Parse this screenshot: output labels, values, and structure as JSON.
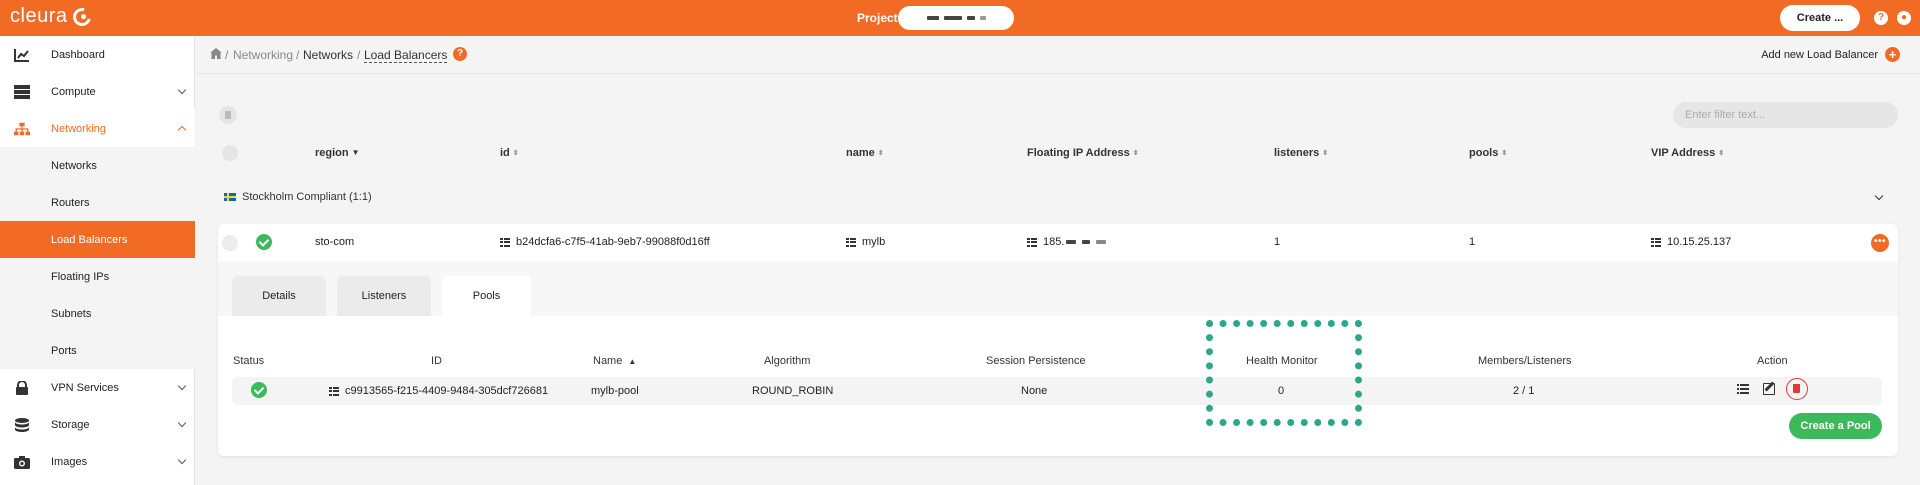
{
  "topbar": {
    "brand": "cleura",
    "project_label": "Project",
    "create_label": "Create ...",
    "accent_color": "#f26b25"
  },
  "sidebar": {
    "items": [
      {
        "label": "Dashboard",
        "icon": "chart-icon"
      },
      {
        "label": "Compute",
        "icon": "server-icon"
      },
      {
        "label": "Networking",
        "icon": "network-icon"
      },
      {
        "label": "Networks"
      },
      {
        "label": "Routers"
      },
      {
        "label": "Load Balancers"
      },
      {
        "label": "Floating IPs"
      },
      {
        "label": "Subnets"
      },
      {
        "label": "Ports"
      },
      {
        "label": "VPN Services",
        "icon": "lock-icon"
      },
      {
        "label": "Storage",
        "icon": "database-icon"
      },
      {
        "label": "Images",
        "icon": "camera-icon"
      }
    ]
  },
  "breadcrumb": {
    "sep": "/",
    "networking": "Networking",
    "networks": "Networks",
    "current": "Load Balancers"
  },
  "header": {
    "add_label": "Add new Load Balancer"
  },
  "filter": {
    "placeholder": "Enter filter text..."
  },
  "table": {
    "headers": {
      "region": "region",
      "id": "id",
      "name": "name",
      "fip": "Floating IP Address",
      "listeners": "listeners",
      "pools": "pools",
      "vip": "VIP Address"
    },
    "region_group": "Stockholm Compliant (1:1)",
    "row": {
      "region": "sto-com",
      "id": "b24dcfa6-c7f5-41ab-9eb7-99088f0d16ff",
      "name": "mylb",
      "fip_prefix": "185.",
      "listeners": "1",
      "pools": "1",
      "vip": "10.15.25.137"
    }
  },
  "tabs": [
    "Details",
    "Listeners",
    "Pools"
  ],
  "pools": {
    "headers": {
      "status": "Status",
      "id": "ID",
      "name": "Name",
      "algorithm": "Algorithm",
      "session": "Session Persistence",
      "health": "Health Monitor",
      "members": "Members/Listeners",
      "action": "Action"
    },
    "row": {
      "id": "c9913565-f215-4409-9484-305dcf726681",
      "name": "mylb-pool",
      "algorithm": "ROUND_ROBIN",
      "session": "None",
      "health": "0",
      "members": "2 / 1"
    },
    "create_label": "Create a Pool",
    "highlight_color": "#2aa889"
  }
}
